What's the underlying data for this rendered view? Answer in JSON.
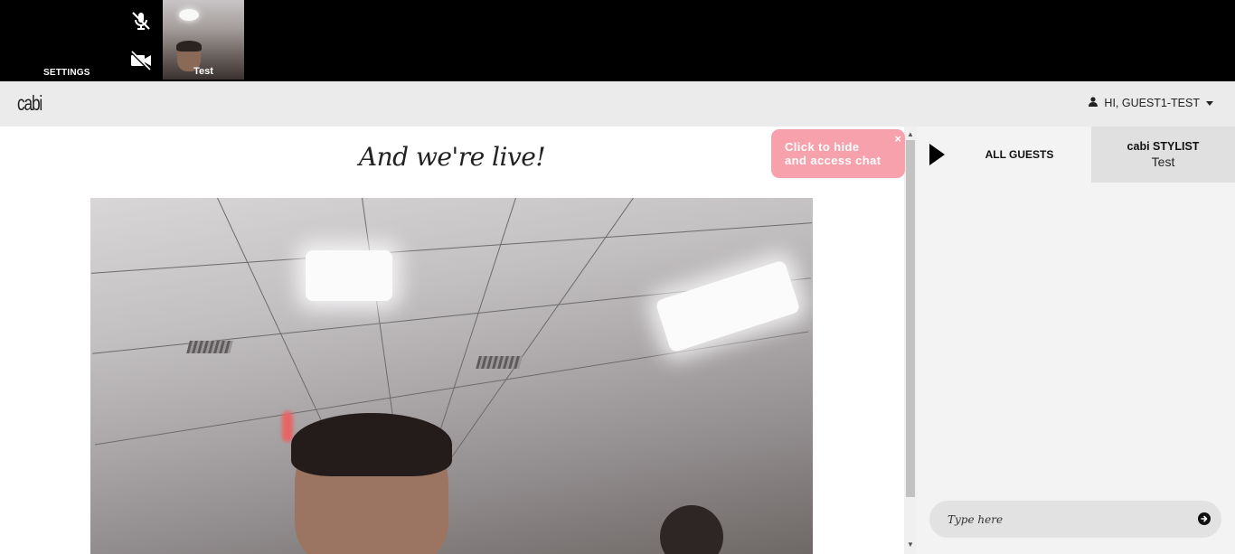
{
  "controls": {
    "settings_label": "SETTINGS",
    "mic_icon": "mic-muted-icon",
    "camera_icon": "camera-off-icon",
    "self_name": "Test"
  },
  "nav": {
    "logo": "cabi",
    "user_greeting": "HI, GUEST1-TEST",
    "user_icon": "user-icon"
  },
  "main": {
    "title": "And we're live!"
  },
  "tooltip": {
    "line1": "Click to hide",
    "line2": "and access chat",
    "close": "×"
  },
  "chat": {
    "tabs": {
      "guests": "ALL GUESTS",
      "stylist_title": "cabi STYLIST",
      "stylist_name": "Test"
    },
    "input_placeholder": "Type here"
  },
  "colors": {
    "topbar": "#000000",
    "navbar": "#ebebeb",
    "tooltip": "#f7a1ad",
    "sidebar": "#f3f3f3"
  }
}
